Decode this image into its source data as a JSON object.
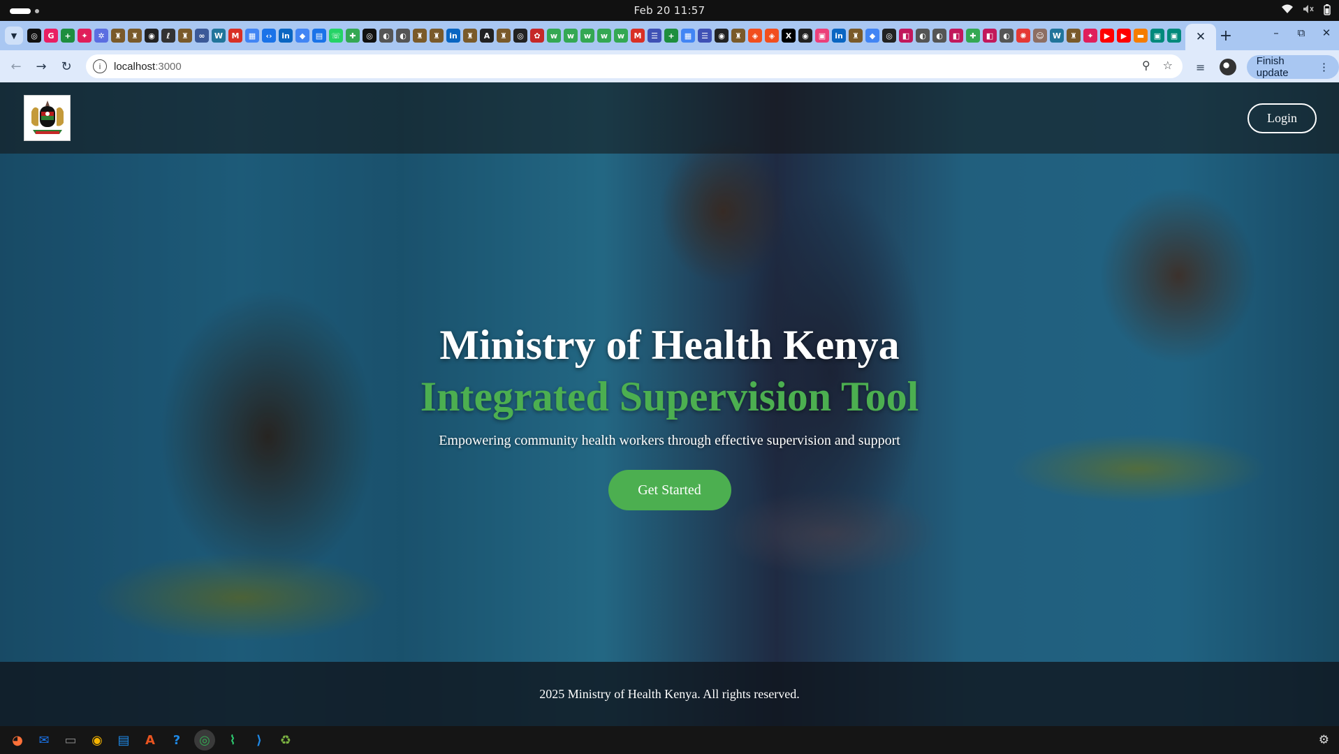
{
  "os": {
    "clock": "Feb 20  11:57",
    "status_icons": [
      "wifi-icon",
      "volume-muted-icon",
      "battery-icon"
    ]
  },
  "browser": {
    "tabs": {
      "pinned_favicons": [
        {
          "icon": "openai-icon",
          "glyph": "◎",
          "color": "#111111"
        },
        {
          "icon": "google-search-icon",
          "glyph": "G",
          "color": "#e91e63"
        },
        {
          "icon": "sheets-plus-icon",
          "glyph": "+",
          "color": "#1e8e3e"
        },
        {
          "icon": "slack-icon",
          "glyph": "✦",
          "color": "#e01e5a"
        },
        {
          "icon": "gear-site-icon",
          "glyph": "✲",
          "color": "#5b6ee1"
        },
        {
          "icon": "coat-of-arms-icon",
          "glyph": "♜",
          "color": "#7a5a2a"
        },
        {
          "icon": "coat-of-arms-icon",
          "glyph": "♜",
          "color": "#7a5a2a"
        },
        {
          "icon": "github-icon",
          "glyph": "◉",
          "color": "#222222"
        },
        {
          "icon": "curl-icon",
          "glyph": "ℓ",
          "color": "#333333"
        },
        {
          "icon": "coat-of-arms-icon",
          "glyph": "♜",
          "color": "#7a5a2a"
        },
        {
          "icon": "link-icon",
          "glyph": "∞",
          "color": "#3b5998"
        },
        {
          "icon": "wordpress-icon",
          "glyph": "W",
          "color": "#21759b"
        },
        {
          "icon": "gmail-icon",
          "glyph": "M",
          "color": "#d93025"
        },
        {
          "icon": "calendar-icon",
          "glyph": "▦",
          "color": "#4285f4"
        },
        {
          "icon": "code-icon",
          "glyph": "‹›",
          "color": "#1a73e8"
        },
        {
          "icon": "linkedin-icon",
          "glyph": "in",
          "color": "#0a66c2"
        },
        {
          "icon": "diamond-icon",
          "glyph": "◆",
          "color": "#4285f4"
        },
        {
          "icon": "chart-icon",
          "glyph": "▤",
          "color": "#1a73e8"
        },
        {
          "icon": "whatsapp-icon",
          "glyph": "☏",
          "color": "#25d366"
        },
        {
          "icon": "maps-icon",
          "glyph": "✚",
          "color": "#34a853"
        },
        {
          "icon": "openai-icon",
          "glyph": "◎",
          "color": "#111111"
        },
        {
          "icon": "globe-icon",
          "glyph": "◐",
          "color": "#555555"
        },
        {
          "icon": "globe-icon",
          "glyph": "◐",
          "color": "#555555"
        },
        {
          "icon": "coat-of-arms-icon",
          "glyph": "♜",
          "color": "#7a5a2a"
        },
        {
          "icon": "coat-of-arms-icon",
          "glyph": "♜",
          "color": "#7a5a2a"
        },
        {
          "icon": "linkedin-icon",
          "glyph": "in",
          "color": "#0a66c2"
        },
        {
          "icon": "coat-of-arms-icon",
          "glyph": "♜",
          "color": "#7a5a2a"
        },
        {
          "icon": "font-icon",
          "glyph": "A",
          "color": "#222222"
        },
        {
          "icon": "coat-of-arms-icon",
          "glyph": "♜",
          "color": "#7a5a2a"
        },
        {
          "icon": "target-icon",
          "glyph": "◎",
          "color": "#222222"
        },
        {
          "icon": "gear-red-icon",
          "glyph": "✿",
          "color": "#c62828"
        },
        {
          "icon": "w-icon",
          "glyph": "w",
          "color": "#34a853"
        },
        {
          "icon": "w-icon",
          "glyph": "w",
          "color": "#34a853"
        },
        {
          "icon": "w-icon",
          "glyph": "w",
          "color": "#34a853"
        },
        {
          "icon": "w-icon",
          "glyph": "w",
          "color": "#34a853"
        },
        {
          "icon": "w-icon",
          "glyph": "w",
          "color": "#34a853"
        },
        {
          "icon": "gmail-icon",
          "glyph": "M",
          "color": "#d93025"
        },
        {
          "icon": "list-icon",
          "glyph": "☰",
          "color": "#3f51b5"
        },
        {
          "icon": "sheets-plus-icon",
          "glyph": "+",
          "color": "#1e8e3e"
        },
        {
          "icon": "calendar-icon",
          "glyph": "▦",
          "color": "#4285f4"
        },
        {
          "icon": "list-icon",
          "glyph": "☰",
          "color": "#3f51b5"
        },
        {
          "icon": "github-icon",
          "glyph": "◉",
          "color": "#222222"
        },
        {
          "icon": "coat-of-arms-icon",
          "glyph": "♜",
          "color": "#7a5a2a"
        },
        {
          "icon": "figma-icon",
          "glyph": "◈",
          "color": "#f24e1e"
        },
        {
          "icon": "figma-icon",
          "glyph": "◈",
          "color": "#f24e1e"
        },
        {
          "icon": "x-icon",
          "glyph": "X",
          "color": "#000000"
        },
        {
          "icon": "github-icon",
          "glyph": "◉",
          "color": "#222222"
        },
        {
          "icon": "pink-square-icon",
          "glyph": "▣",
          "color": "#ec407a"
        },
        {
          "icon": "linkedin-icon",
          "glyph": "in",
          "color": "#0a66c2"
        },
        {
          "icon": "coat-of-arms-icon",
          "glyph": "♜",
          "color": "#7a5a2a"
        },
        {
          "icon": "diamond-icon",
          "glyph": "◆",
          "color": "#4285f4"
        },
        {
          "icon": "target-icon",
          "glyph": "◎",
          "color": "#222222"
        },
        {
          "icon": "app-icon",
          "glyph": "◧",
          "color": "#c2185b"
        },
        {
          "icon": "globe-icon",
          "glyph": "◐",
          "color": "#555555"
        },
        {
          "icon": "globe-icon",
          "glyph": "◐",
          "color": "#555555"
        },
        {
          "icon": "app-icon",
          "glyph": "◧",
          "color": "#c2185b"
        },
        {
          "icon": "maps-icon",
          "glyph": "✚",
          "color": "#34a853"
        },
        {
          "icon": "app-icon",
          "glyph": "◧",
          "color": "#c2185b"
        },
        {
          "icon": "globe-icon",
          "glyph": "◐",
          "color": "#555555"
        },
        {
          "icon": "burst-icon",
          "glyph": "✺",
          "color": "#e53935"
        },
        {
          "icon": "portrait-icon",
          "glyph": "☺",
          "color": "#8d6e63"
        },
        {
          "icon": "wordpress-icon",
          "glyph": "W",
          "color": "#21759b"
        },
        {
          "icon": "coat-of-arms-icon",
          "glyph": "♜",
          "color": "#7a5a2a"
        },
        {
          "icon": "slack-icon",
          "glyph": "✦",
          "color": "#e01e5a"
        },
        {
          "icon": "youtube-icon",
          "glyph": "▶",
          "color": "#ff0000"
        },
        {
          "icon": "youtube-icon",
          "glyph": "▶",
          "color": "#ff0000"
        },
        {
          "icon": "orange-doc-icon",
          "glyph": "▬",
          "color": "#f57c00"
        },
        {
          "icon": "teal-box-icon",
          "glyph": "▣",
          "color": "#00897b"
        },
        {
          "icon": "teal-box-icon",
          "glyph": "▣",
          "color": "#00897b"
        },
        {
          "icon": "globe-icon",
          "glyph": "◐",
          "color": "#555555"
        },
        {
          "icon": "google-search-icon",
          "glyph": "G",
          "color": "#e91e63"
        }
      ],
      "active_tab_close_glyph": "✕",
      "new_tab_glyph": "+"
    },
    "window_controls": [
      "–",
      "⧉",
      "✕"
    ],
    "toolbar": {
      "back_glyph": "←",
      "forward_glyph": "→",
      "reload_glyph": "↻",
      "site_info_glyph": "i",
      "url_host": "localhost",
      "url_port": ":3000",
      "zoom_glyph": "⚲",
      "bookmark_glyph": "☆",
      "media_glyph": "≡",
      "finish_update_label": "Finish update",
      "menu_glyph": "⋮"
    }
  },
  "page": {
    "header": {
      "logo_alt": "Kenya coat of arms",
      "login_label": "Login"
    },
    "hero": {
      "title": "Ministry of Health Kenya",
      "subtitle": "Integrated Supervision Tool",
      "tagline": "Empowering community health workers through effective supervision and support",
      "cta_label": "Get Started"
    },
    "footer": {
      "copyright": "2025 Ministry of Health Kenya. All rights reserved."
    },
    "colors": {
      "accent_green": "#4caf50",
      "tab_strip": "#a9c7f2",
      "toolbar": "#dfeafb"
    }
  },
  "taskbar": {
    "apps": [
      {
        "name": "firefox-icon",
        "glyph": "◕",
        "color": "#ff7139"
      },
      {
        "name": "thunderbird-icon",
        "glyph": "✉",
        "color": "#1a73e8"
      },
      {
        "name": "files-icon",
        "glyph": "▭",
        "color": "#8a8a8a"
      },
      {
        "name": "rhythmbox-icon",
        "glyph": "◉",
        "color": "#f5b400"
      },
      {
        "name": "writer-icon",
        "glyph": "▤",
        "color": "#1e88e5"
      },
      {
        "name": "app-center-icon",
        "glyph": "A",
        "color": "#e95420"
      },
      {
        "name": "help-icon",
        "glyph": "?",
        "color": "#1e88e5"
      },
      {
        "name": "chrome-icon",
        "glyph": "◎",
        "color": "#34a853"
      },
      {
        "name": "terminal-icon",
        "glyph": "⌇",
        "color": "#2ecc71"
      },
      {
        "name": "vscode-icon",
        "glyph": "⟩",
        "color": "#1e88e5"
      },
      {
        "name": "trash-icon",
        "glyph": "♻",
        "color": "#7cb342"
      }
    ],
    "tray_glyph": "⚙"
  }
}
